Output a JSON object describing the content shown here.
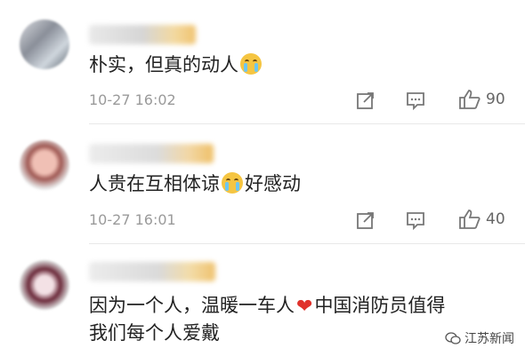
{
  "comments": [
    {
      "text": "朴实，但真的动人",
      "emoji": "crying-face",
      "time": "10-27 16:02",
      "likes": "90"
    },
    {
      "text_before": "人贵在互相体谅",
      "emoji": "crying-face",
      "text_after": "好感动",
      "time": "10-27 16:01",
      "likes": "40"
    },
    {
      "line1_before": "因为一个人，温暖一车人",
      "heart": "❤",
      "line1_after": "中国消防员值得",
      "line2": "我们每个人爱戴"
    }
  ],
  "watermark": {
    "label": "江苏新闻"
  },
  "colors": {
    "heart": "#e0312b",
    "time": "#9a9a9a",
    "text": "#222222"
  },
  "icons": [
    "share-icon",
    "comment-icon",
    "like-icon"
  ]
}
